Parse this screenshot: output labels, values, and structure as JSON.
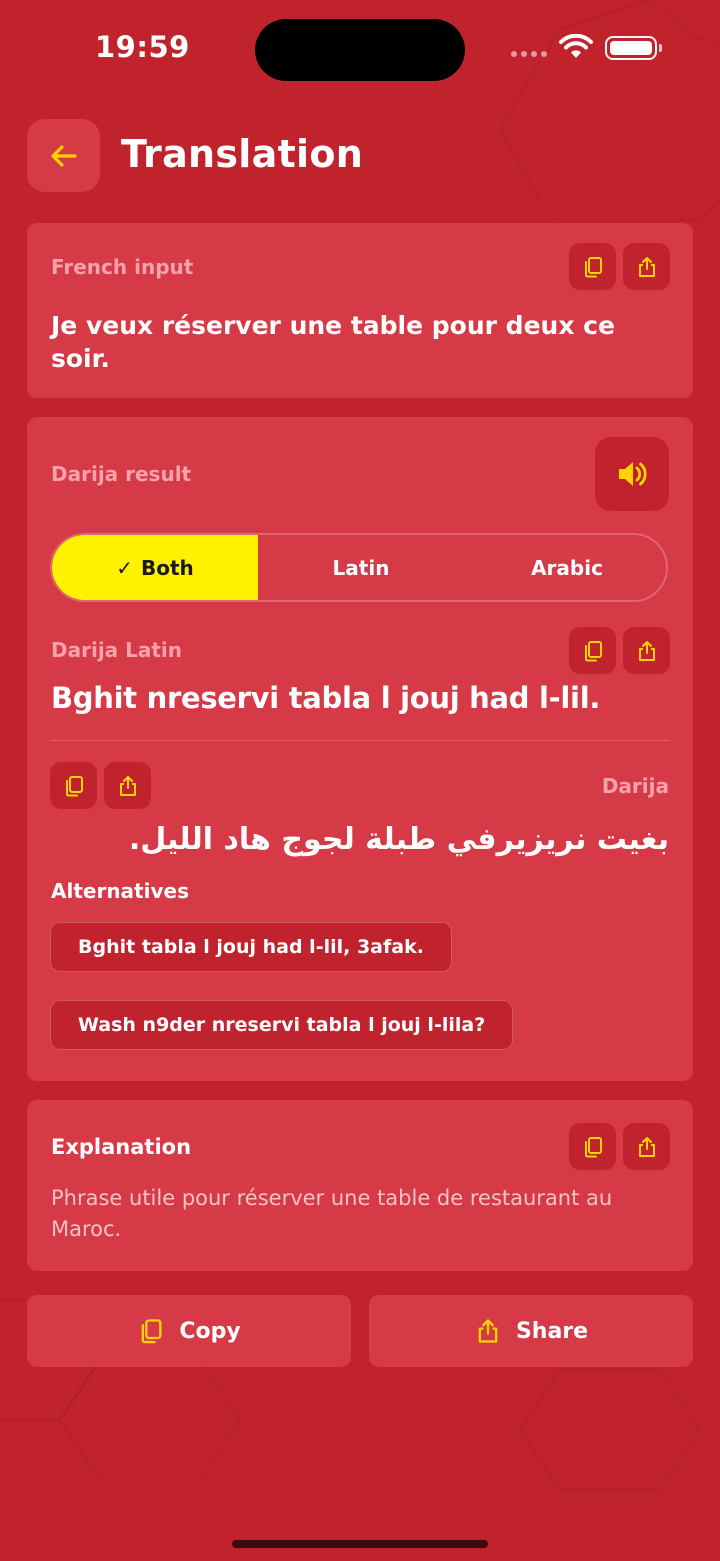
{
  "status": {
    "time": "19:59"
  },
  "header": {
    "title": "Translation",
    "back_icon": "arrow-left-icon"
  },
  "input_card": {
    "label": "French input",
    "text": "Je veux réserver une table pour deux ce soir."
  },
  "result_card": {
    "label": "Darija result",
    "segments": [
      {
        "label": "Both",
        "active": true
      },
      {
        "label": "Latin",
        "active": false
      },
      {
        "label": "Arabic",
        "active": false
      }
    ],
    "latin_label": "Darija Latin",
    "latin_text": "Bghit nreservi tabla l jouj had l-lil.",
    "arabic_label": "Darija",
    "arabic_text": "بغيت نريزيرفي طبلة لجوج هاد الليل.",
    "alternatives_title": "Alternatives",
    "alternatives": [
      "Bghit tabla l jouj had l-lil, 3afak.",
      "Wash n9der nreservi tabla l jouj l-lila?"
    ]
  },
  "explanation_card": {
    "title": "Explanation",
    "text": "Phrase utile pour réserver une table de restaurant au Maroc."
  },
  "actions": {
    "copy_label": "Copy",
    "share_label": "Share"
  },
  "colors": {
    "background": "#c1232d",
    "card": "#d63a47",
    "accent": "#fff200",
    "icon_yellow": "#ffd400"
  }
}
